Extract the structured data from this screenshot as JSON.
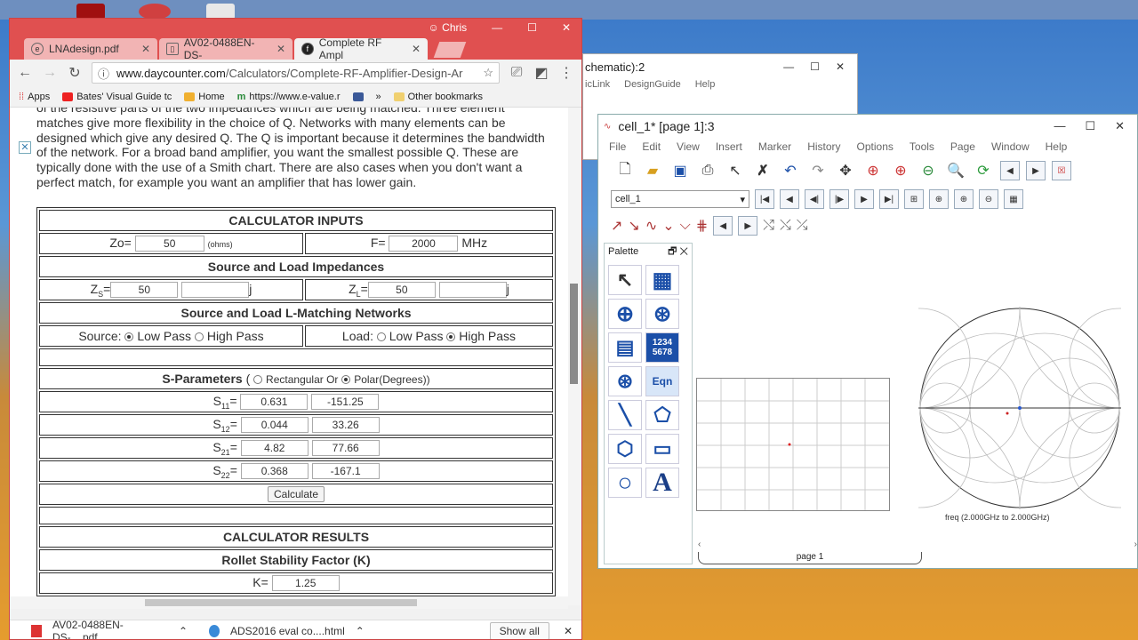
{
  "desktop": {
    "colors": {
      "sky": "#5a97d6",
      "sand": "#e59c2e"
    }
  },
  "schematic_window": {
    "title": "chematic):2",
    "menu": [
      "icLink",
      "DesignGuide",
      "Help"
    ]
  },
  "data_display": {
    "title": "cell_1* [page 1]:3",
    "menu": [
      "File",
      "Edit",
      "View",
      "Insert",
      "Marker",
      "History",
      "Options",
      "Tools",
      "Page",
      "Window",
      "Help"
    ],
    "cell_select": "cell_1",
    "palette_title": "Palette",
    "palette_items": [
      "pointer-icon",
      "table-grid-icon",
      "polar-icon",
      "smith-icon",
      "list-icon",
      "1234\n5678",
      "antenna-icon",
      "Eqn",
      "line-icon",
      "polygon-icon",
      "polyline-icon",
      "rectangle-icon",
      "circle-icon",
      "A"
    ],
    "smith_caption": "freq (2.000GHz to 2.000GHz)",
    "page_tab": "page 1"
  },
  "browser": {
    "profile": "Chris",
    "tabs": [
      {
        "title": "LNAdesign.pdf"
      },
      {
        "title": "AV02-0488EN-DS-"
      },
      {
        "title": "Complete RF Ampl"
      }
    ],
    "url_host": "www.daycounter.com",
    "url_path": "/Calculators/Complete-RF-Amplifier-Design-Ar",
    "bookmarks": [
      "Apps",
      "Bates' Visual Guide tc",
      "Home",
      "https://www.e-value.r",
      "Other bookmarks"
    ],
    "paragraph": "of the resistive parts of the two impedances which are being matched. Three element matches give more flexibility in the choice of Q. Networks with many elements can be designed which give any desired Q. The Q is important because it determines the bandwidth of the network.  For a broad band amplifier, you want the smallest possible Q.  These are typically done with the use of a Smith chart. There are also cases when you don't want a perfect match, for example you want an amplifier that has lower gain.",
    "downloads": [
      {
        "name": "AV02-0488EN-DS-....pdf"
      },
      {
        "name": "ADS2016 eval co....html"
      }
    ],
    "show_all": "Show all"
  },
  "calculator": {
    "inputs_header": "CALCULATOR INPUTS",
    "zo_label": "Zo=",
    "zo_value": "50",
    "zo_unit": "(ohms)",
    "f_label": "F=",
    "f_value": "2000",
    "f_unit": "MHz",
    "impedance_header": "Source and Load Impedances",
    "zs_real": "50",
    "zs_imag": "",
    "zl_real": "50",
    "zl_imag": "",
    "j": "j",
    "network_header": "Source and Load L-Matching Networks",
    "source_label": "Source:",
    "load_label": "Load:",
    "low_pass": "Low Pass",
    "high_pass": "High Pass",
    "sparams_header": "S-Parameters",
    "rect_label": "Rectangular Or",
    "polar_label": "Polar(Degrees))",
    "s11": [
      "0.631",
      "-151.25"
    ],
    "s12": [
      "0.044",
      "33.26"
    ],
    "s21": [
      "4.82",
      "77.66"
    ],
    "s22": [
      "0.368",
      "-167.1"
    ],
    "calculate": "Calculate",
    "results_header": "CALCULATOR RESULTS",
    "rollet_header": "Rollet Stability Factor (K)",
    "k_label": "K=",
    "k_value": "1.25"
  }
}
